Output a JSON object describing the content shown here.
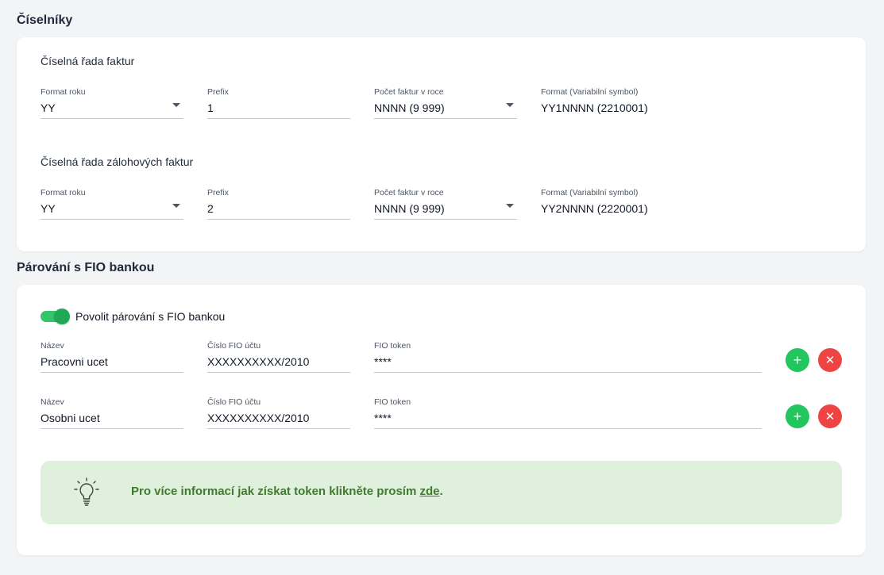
{
  "numbering": {
    "section_title": "Číselníky",
    "invoices": {
      "title": "Číselná řada faktur",
      "year_format_label": "Format roku",
      "year_format_value": "YY",
      "prefix_label": "Prefix",
      "prefix_value": "1",
      "count_label": "Počet faktur v roce",
      "count_value": "NNNN (9 999)",
      "format_label": "Format (Variabilní symbol)",
      "format_value": "YY1NNNN (2210001)"
    },
    "advance_invoices": {
      "title": "Číselná řada zálohových faktur",
      "year_format_label": "Format roku",
      "year_format_value": "YY",
      "prefix_label": "Prefix",
      "prefix_value": "2",
      "count_label": "Počet faktur v roce",
      "count_value": "NNNN (9 999)",
      "format_label": "Format (Variabilní symbol)",
      "format_value": "YY2NNNN (2220001)"
    }
  },
  "fio": {
    "section_title": "Párování s FIO bankou",
    "toggle_label": "Povolit párování s FIO bankou",
    "toggle_on": true,
    "accounts": [
      {
        "name_label": "Název",
        "name_value": "Pracovni ucet",
        "number_label": "Číslo FIO účtu",
        "number_value": "XXXXXXXXXX/2010",
        "token_label": "FIO token",
        "token_value": "****",
        "add_icon": "+",
        "remove_icon": "✕"
      },
      {
        "name_label": "Název",
        "name_value": "Osobni ucet",
        "number_label": "Číslo FIO účtu",
        "number_value": "XXXXXXXXXX/2010",
        "token_label": "FIO token",
        "token_value": "****",
        "add_icon": "+",
        "remove_icon": "✕"
      }
    ],
    "info": {
      "text": "Pro více informací jak získat token klikněte prosím ",
      "link_text": "zde",
      "suffix": ".",
      "icon": "lightbulb-icon"
    }
  },
  "colors": {
    "accent_green": "#22c55e",
    "danger_red": "#ef4444",
    "info_bg": "#dff0dc",
    "info_text": "#3f7a2e"
  }
}
